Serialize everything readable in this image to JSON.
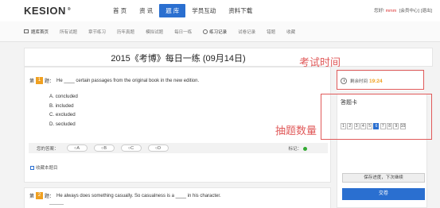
{
  "header": {
    "logo": "KESION",
    "logo_mark": "®",
    "nav": [
      {
        "label": "首 页",
        "active": false
      },
      {
        "label": "资 讯",
        "active": false
      },
      {
        "label": "题 库",
        "active": true
      },
      {
        "label": "学员互动",
        "active": false
      },
      {
        "label": "资料下载",
        "active": false
      }
    ],
    "greeting": "您好!",
    "username": "mmm",
    "member_center": "[会员中心]",
    "logout": "[退出]"
  },
  "subnav": [
    {
      "label": "题库首页"
    },
    {
      "label": "所有试题"
    },
    {
      "label": "章节练习"
    },
    {
      "label": "历年真题"
    },
    {
      "label": "模拟试题"
    },
    {
      "label": "每日一练"
    },
    {
      "label": "练习记录"
    },
    {
      "label": "试卷记录"
    },
    {
      "label": "错题"
    },
    {
      "label": "收藏"
    }
  ],
  "page": {
    "title": "2015《考博》每日一练 (09月14日)"
  },
  "question1": {
    "prefix": "第",
    "num": "1",
    "suffix": "题：",
    "text": "He ____ certain passages from the original book in the new edition.",
    "options": [
      "A. concluded",
      "B. included",
      "C. excluded",
      "D. secluded"
    ]
  },
  "answer": {
    "label": "您的答案：",
    "options": [
      "○A",
      "○B",
      "○C",
      "○D"
    ],
    "mark_label": "标记："
  },
  "collect_label": "收藏本题目",
  "question2": {
    "prefix": "第",
    "num": "2",
    "suffix": "题：",
    "text": "He always does something casually. So casualness is a ____ in his character."
  },
  "sidebar": {
    "timer_label": "剩余时间",
    "timer_value": "19:24",
    "card_title": "答题卡",
    "numbers": [
      "1",
      "2",
      "3",
      "4",
      "5",
      "6",
      "7",
      "8",
      "9",
      "10"
    ],
    "current": 6,
    "save_label": "保存进度，下次继续",
    "submit_label": "交卷"
  },
  "annotations": {
    "time": "考试时间",
    "count": "抽题数量"
  },
  "colors": {
    "accent": "#2a6fd0",
    "orange": "#f0a020",
    "annotation": "#e05a5a"
  }
}
